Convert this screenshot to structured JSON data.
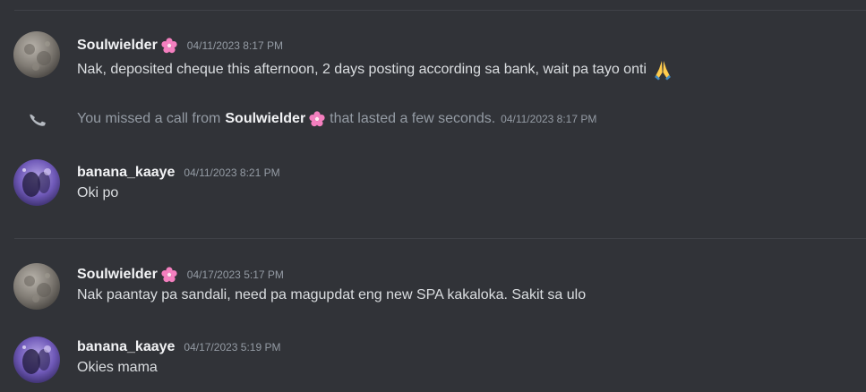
{
  "messages": [
    {
      "username": "Soulwielder",
      "badge": "cherry-blossom-icon",
      "timestamp": "04/11/2023 8:17 PM",
      "text": "Nak, deposited cheque this afternoon, 2 days posting according sa bank, wait pa tayo onti",
      "emoji": "folded-hands-icon"
    },
    {
      "type": "missed-call",
      "icon": "phone-missed-icon",
      "prefix": "You missed a call from",
      "username": "Soulwielder",
      "badge": "cherry-blossom-icon",
      "suffix": "that lasted a few seconds.",
      "timestamp": "04/11/2023 8:17 PM"
    },
    {
      "username": "banana_kaaye",
      "timestamp": "04/11/2023 8:21 PM",
      "text": "Oki po"
    },
    {
      "username": "Soulwielder",
      "badge": "cherry-blossom-icon",
      "timestamp": "04/17/2023 5:17 PM",
      "text": "Nak paantay pa sandali, need pa magupdat eng new SPA kakaloka. Sakit sa ulo"
    },
    {
      "username": "banana_kaaye",
      "timestamp": "04/17/2023 5:19 PM",
      "text": "Okies mama"
    }
  ],
  "colors": {
    "background": "#313338",
    "username": "#f2f3f5",
    "text": "#dbdee1",
    "muted": "#949ba4",
    "divider": "#3f4147",
    "badge_pink": "#f47fbf"
  }
}
